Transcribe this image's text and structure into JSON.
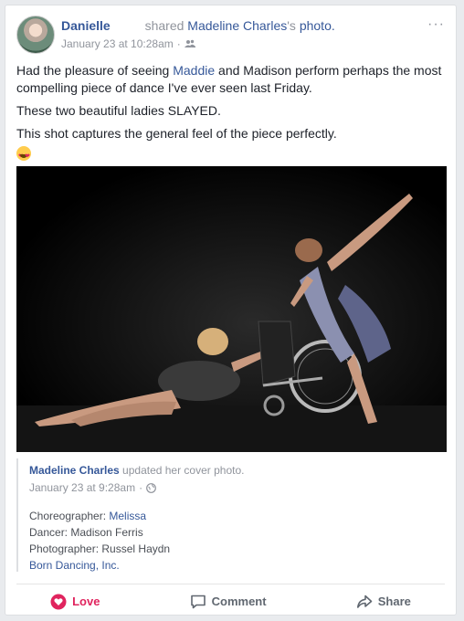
{
  "post": {
    "author": "Danielle",
    "shared_word": "shared",
    "shared_owner": "Madeline Charles",
    "possessive": "'s",
    "photo_word": "photo.",
    "timestamp": "January 23 at 10:28am",
    "separator": "·",
    "privacy_icon": "friends-icon",
    "more_label": "···",
    "text": {
      "line1_a": "Had the pleasure of seeing ",
      "line1_link": "Maddie",
      "line1_b": " and Madison perform perhaps the most compelling piece of dance I've ever seen last Friday.",
      "line2": "These two beautiful ladies SLAYED.",
      "line3": "This shot captures the general feel of the piece perfectly."
    }
  },
  "shared": {
    "author": "Madeline Charles",
    "action": "updated her cover photo.",
    "timestamp": "January 23 at 9:28am",
    "separator": "·",
    "choreographer_label": "Choreographer: ",
    "choreographer_link": "Melissa",
    "dancer": "Dancer: Madison Ferris",
    "photographer": "Photographer: Russel Haydn",
    "company_link": "Born Dancing, Inc."
  },
  "actions": {
    "love": "Love",
    "comment": "Comment",
    "share": "Share"
  },
  "colors": {
    "link": "#365899",
    "love": "#e0245e",
    "muted": "#90949c"
  }
}
